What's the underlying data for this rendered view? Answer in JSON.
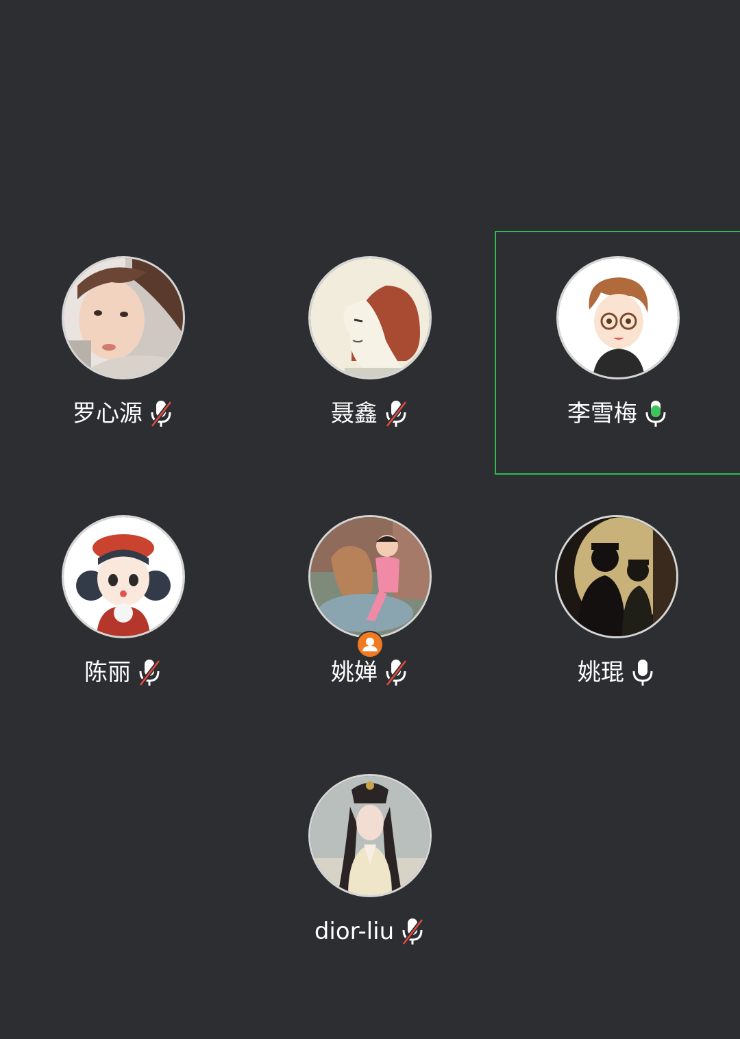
{
  "participants": [
    {
      "name": "罗心源",
      "mic": "muted",
      "avatar_icon": "girl-photo-avatar",
      "speaking": false,
      "host": false
    },
    {
      "name": "聂鑫",
      "mic": "muted",
      "avatar_icon": "cartoon-profile-avatar",
      "speaking": false,
      "host": false
    },
    {
      "name": "李雪梅",
      "mic": "active",
      "avatar_icon": "glasses-cartoon-avatar",
      "speaking": true,
      "host": false
    },
    {
      "name": "陈丽",
      "mic": "muted",
      "avatar_icon": "red-beret-cartoon-avatar",
      "speaking": false,
      "host": false
    },
    {
      "name": "姚婵",
      "mic": "muted",
      "avatar_icon": "child-on-horse-avatar",
      "speaking": false,
      "host": true
    },
    {
      "name": "姚琨",
      "mic": "on",
      "avatar_icon": "silhouette-couple-avatar",
      "speaking": false,
      "host": false
    },
    {
      "name": "dior-liu",
      "mic": "muted",
      "avatar_icon": "costume-woman-avatar",
      "speaking": false,
      "host": false
    }
  ],
  "colors": {
    "background": "#2c2e31",
    "speaking_border": "#2fb950",
    "mic_active": "#3ec45a",
    "mic_muted_slash": "#e64a3c",
    "host_badge": "#f07b22"
  }
}
